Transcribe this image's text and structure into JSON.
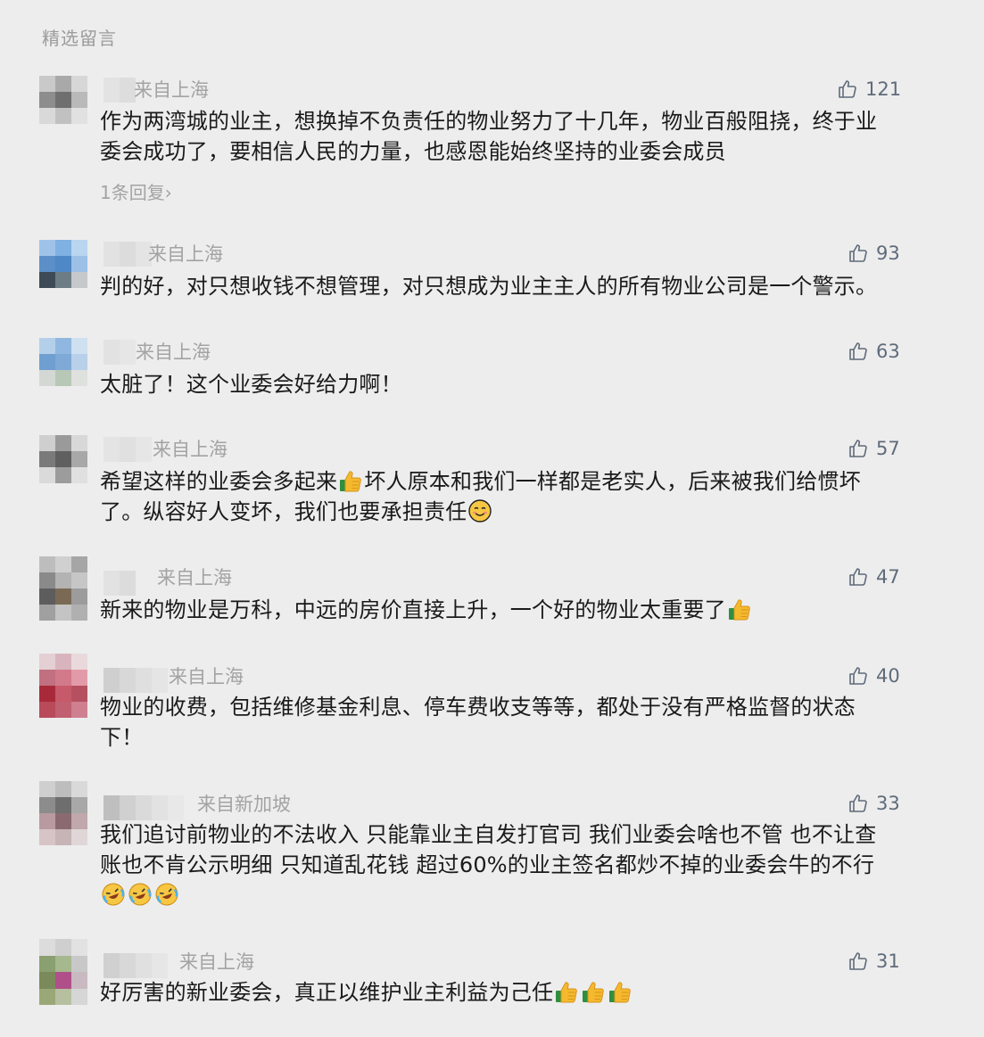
{
  "section_title": "精选留言",
  "comments": [
    {
      "location": "来自上海",
      "likes": "121",
      "lines": [
        "作为两湾城的业主，想换掉不负责任的物业努力了十几年，物业百般阻挠，终于业",
        "委会成功了，要相信人民的力量，也感恩能始终坚持的业委会成员"
      ],
      "reply": "1条回复"
    },
    {
      "location": "来自上海",
      "likes": "93",
      "lines": [
        "判的好，对只想收钱不想管理，对只想成为业主主人的所有物业公司是一个警示。"
      ]
    },
    {
      "location": "来自上海",
      "likes": "63",
      "lines": [
        "太脏了！这个业委会好给力啊！"
      ]
    },
    {
      "location": "来自上海",
      "likes": "57",
      "line1_a": "希望这样的业委会多起来",
      "line1_b": "坏人原本和我们一样都是老实人，后来被我们给惯坏",
      "line2": "了。纵容好人变坏，我们也要承担责任"
    },
    {
      "location": "来自上海",
      "likes": "47",
      "line1": "新来的物业是万科，中远的房价直接上升，一个好的物业太重要了"
    },
    {
      "location": "来自上海",
      "likes": "40",
      "lines": [
        "物业的收费，包括维修基金利息、停车费收支等等，都处于没有严格监督的状态",
        "下！"
      ]
    },
    {
      "location": "来自新加坡",
      "likes": "33",
      "lines": [
        "我们追讨前物业的不法收入 只能靠业主自发打官司 我们业委会啥也不管 也不让查",
        "账也不肯公示明细 只知道乱花钱 超过60%的业主签名都炒不掉的业委会牛的不行"
      ]
    },
    {
      "location": "来自上海",
      "likes": "31",
      "line1": "好厉害的新业委会，真正以维护业主利益为己任"
    }
  ],
  "icons": {
    "like": "thumbs-up-outline-icon",
    "thumbs_emoji": "thumbs-up-emoji",
    "smile_emoji": "smiling-face-emoji",
    "laugh_cry_emoji": "rolling-laughing-emoji"
  },
  "colors": {
    "background": "#ededed",
    "meta_gray": "#a3a3a3",
    "like_gray": "#5f6b7a",
    "text": "#1a1a1a"
  }
}
